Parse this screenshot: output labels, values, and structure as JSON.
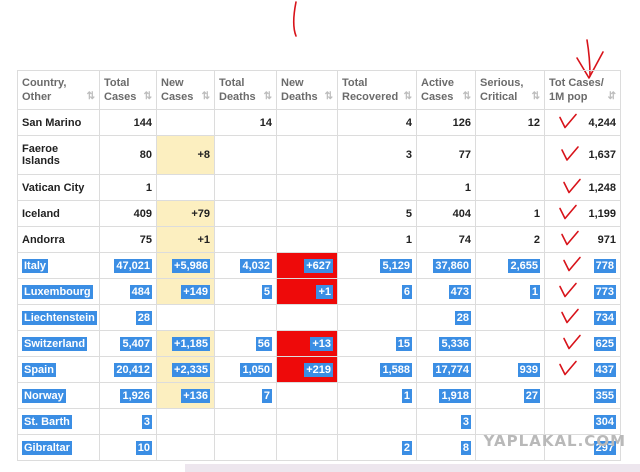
{
  "headers": [
    {
      "line1": "Country,",
      "line2": "Other"
    },
    {
      "line1": "Total",
      "line2": "Cases"
    },
    {
      "line1": "New",
      "line2": "Cases"
    },
    {
      "line1": "Total",
      "line2": "Deaths"
    },
    {
      "line1": "New",
      "line2": "Deaths"
    },
    {
      "line1": "Total",
      "line2": "Recovered"
    },
    {
      "line1": "Active",
      "line2": "Cases"
    },
    {
      "line1": "Serious,",
      "line2": "Critical"
    },
    {
      "line1": "Tot Cases/",
      "line2": "1M pop"
    }
  ],
  "rows": [
    {
      "country": "San Marino",
      "total_cases": "144",
      "new_cases": "",
      "total_deaths": "14",
      "new_deaths": "",
      "total_recovered": "4",
      "active_cases": "126",
      "serious_critical": "12",
      "per_million": "4,244"
    },
    {
      "country": "Faeroe Islands",
      "total_cases": "80",
      "new_cases": "+8",
      "total_deaths": "",
      "new_deaths": "",
      "total_recovered": "3",
      "active_cases": "77",
      "serious_critical": "",
      "per_million": "1,637"
    },
    {
      "country": "Vatican City",
      "total_cases": "1",
      "new_cases": "",
      "total_deaths": "",
      "new_deaths": "",
      "total_recovered": "",
      "active_cases": "1",
      "serious_critical": "",
      "per_million": "1,248"
    },
    {
      "country": "Iceland",
      "total_cases": "409",
      "new_cases": "+79",
      "total_deaths": "",
      "new_deaths": "",
      "total_recovered": "5",
      "active_cases": "404",
      "serious_critical": "1",
      "per_million": "1,199"
    },
    {
      "country": "Andorra",
      "total_cases": "75",
      "new_cases": "+1",
      "total_deaths": "",
      "new_deaths": "",
      "total_recovered": "1",
      "active_cases": "74",
      "serious_critical": "2",
      "per_million": "971"
    },
    {
      "country": "Italy",
      "total_cases": "47,021",
      "new_cases": "+5,986",
      "total_deaths": "4,032",
      "new_deaths": "+627",
      "total_recovered": "5,129",
      "active_cases": "37,860",
      "serious_critical": "2,655",
      "per_million": "778"
    },
    {
      "country": "Luxembourg",
      "total_cases": "484",
      "new_cases": "+149",
      "total_deaths": "5",
      "new_deaths": "+1",
      "total_recovered": "6",
      "active_cases": "473",
      "serious_critical": "1",
      "per_million": "773"
    },
    {
      "country": "Liechtenstein",
      "total_cases": "28",
      "new_cases": "",
      "total_deaths": "",
      "new_deaths": "",
      "total_recovered": "",
      "active_cases": "28",
      "serious_critical": "",
      "per_million": "734"
    },
    {
      "country": "Switzerland",
      "total_cases": "5,407",
      "new_cases": "+1,185",
      "total_deaths": "56",
      "new_deaths": "+13",
      "total_recovered": "15",
      "active_cases": "5,336",
      "serious_critical": "",
      "per_million": "625"
    },
    {
      "country": "Spain",
      "total_cases": "20,412",
      "new_cases": "+2,335",
      "total_deaths": "1,050",
      "new_deaths": "+219",
      "total_recovered": "1,588",
      "active_cases": "17,774",
      "serious_critical": "939",
      "per_million": "437"
    },
    {
      "country": "Norway",
      "total_cases": "1,926",
      "new_cases": "+136",
      "total_deaths": "7",
      "new_deaths": "",
      "total_recovered": "1",
      "active_cases": "1,918",
      "serious_critical": "27",
      "per_million": "355"
    },
    {
      "country": "St. Barth",
      "total_cases": "3",
      "new_cases": "",
      "total_deaths": "",
      "new_deaths": "",
      "total_recovered": "",
      "active_cases": "3",
      "serious_critical": "",
      "per_million": "304"
    },
    {
      "country": "Gibraltar",
      "total_cases": "10",
      "new_cases": "",
      "total_deaths": "",
      "new_deaths": "",
      "total_recovered": "2",
      "active_cases": "8",
      "serious_critical": "",
      "per_million": "297"
    }
  ],
  "watermark": "YAPLAKAL.COM",
  "colors": {
    "new_cases_bg": "#fcefc0",
    "new_deaths_bg": "#ee0a0a",
    "selection_bg": "#3b8ee4",
    "annotation": "#d8131a"
  }
}
